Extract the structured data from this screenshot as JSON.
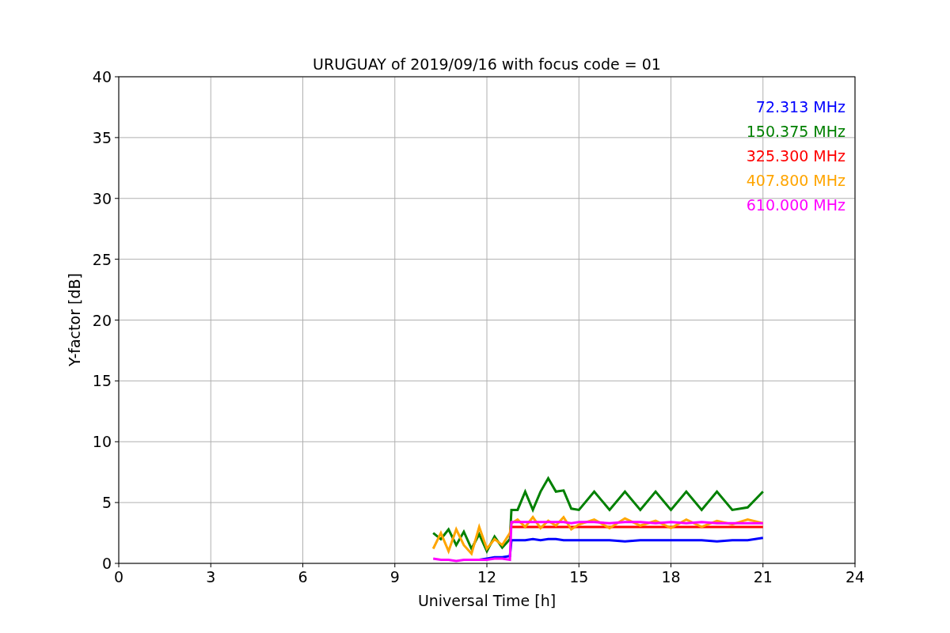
{
  "chart_data": {
    "type": "line",
    "title": "URUGUAY of 2019/09/16 with focus code = 01",
    "xlabel": "Universal Time [h]",
    "ylabel": "Y-factor [dB]",
    "grid": true,
    "xlim": [
      0,
      24
    ],
    "ylim": [
      0,
      40
    ],
    "xticks": [
      0,
      3,
      6,
      9,
      12,
      15,
      18,
      21,
      24
    ],
    "yticks": [
      0,
      5,
      10,
      15,
      20,
      25,
      30,
      35,
      40
    ],
    "x": [
      10.25,
      10.5,
      10.75,
      11,
      11.25,
      11.5,
      11.75,
      12,
      12.25,
      12.5,
      12.75,
      12.8,
      13,
      13.25,
      13.5,
      13.75,
      14,
      14.25,
      14.5,
      14.75,
      15,
      15.5,
      16,
      16.5,
      17,
      17.5,
      18,
      18.5,
      19,
      19.5,
      20,
      20.5,
      21
    ],
    "series": [
      {
        "name": "72.313 MHz",
        "color": "#0000ff",
        "values": [
          null,
          null,
          null,
          null,
          null,
          null,
          0.3,
          0.4,
          0.5,
          0.5,
          0.6,
          1.9,
          1.9,
          1.9,
          2.0,
          1.9,
          2.0,
          2.0,
          1.9,
          1.9,
          1.9,
          1.9,
          1.9,
          1.8,
          1.9,
          1.9,
          1.9,
          1.9,
          1.9,
          1.8,
          1.9,
          1.9,
          2.1
        ]
      },
      {
        "name": "150.375 MHz",
        "color": "#008000",
        "values": [
          2.5,
          2.0,
          2.8,
          1.5,
          2.6,
          1.2,
          2.4,
          1.0,
          2.2,
          1.3,
          2.0,
          4.4,
          4.4,
          5.9,
          4.4,
          5.9,
          7.0,
          5.9,
          6.0,
          4.5,
          4.4,
          5.9,
          4.4,
          5.9,
          4.4,
          5.9,
          4.4,
          5.9,
          4.4,
          5.9,
          4.4,
          4.6,
          5.9
        ]
      },
      {
        "name": "325.300 MHz",
        "color": "#ff0000",
        "values": [
          null,
          null,
          null,
          null,
          null,
          null,
          null,
          null,
          null,
          null,
          null,
          3.0,
          3.0,
          3.0,
          3.0,
          3.0,
          3.0,
          3.0,
          3.0,
          3.0,
          3.0,
          3.0,
          3.0,
          3.0,
          3.0,
          3.0,
          3.0,
          3.0,
          3.0,
          3.0,
          3.0,
          3.0,
          3.0
        ]
      },
      {
        "name": "407.800 MHz",
        "color": "#ffa500",
        "values": [
          1.2,
          2.5,
          1.0,
          2.8,
          1.5,
          0.8,
          3.0,
          1.2,
          2.0,
          1.5,
          2.5,
          3.3,
          3.6,
          3.0,
          3.8,
          2.9,
          3.5,
          3.1,
          3.8,
          2.8,
          3.2,
          3.6,
          2.9,
          3.7,
          3.1,
          3.5,
          2.9,
          3.6,
          3.0,
          3.5,
          3.2,
          3.6,
          3.3
        ]
      },
      {
        "name": "610.000 MHz",
        "color": "#ff00ff",
        "values": [
          0.4,
          0.3,
          0.3,
          0.2,
          0.3,
          0.3,
          0.3,
          0.3,
          0.4,
          0.4,
          0.3,
          3.4,
          3.4,
          3.4,
          3.4,
          3.4,
          3.4,
          3.4,
          3.4,
          3.3,
          3.4,
          3.4,
          3.3,
          3.4,
          3.4,
          3.3,
          3.4,
          3.3,
          3.4,
          3.3,
          3.3,
          3.3,
          3.3
        ]
      }
    ]
  }
}
